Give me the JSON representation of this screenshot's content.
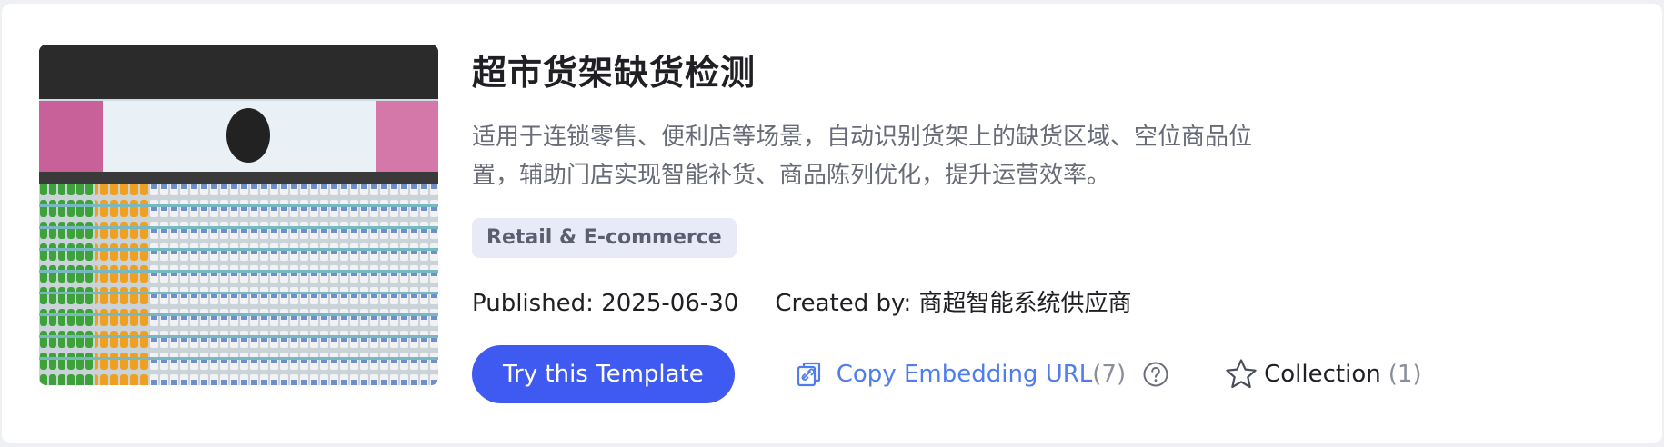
{
  "template": {
    "title": "超市货架缺货检测",
    "description": "适用于连锁零售、便利店等场景，自动识别货架上的缺货区域、空位商品位置，辅助门店实现智能补货、商品陈列优化，提升运营效率。",
    "tag": "Retail & E-commerce",
    "published": "Published: 2025-06-30",
    "created_by": "Created by: 商超智能系统供应商"
  },
  "actions": {
    "try_label": "Try this Template",
    "copy_label": "Copy Embedding URL",
    "copy_count": "(7)",
    "collection_label": "Collection",
    "collection_count": "(1)"
  },
  "icons": {
    "copy": "link-copy-icon",
    "help": "question-circle-icon",
    "collection": "star-outline-icon"
  },
  "colors": {
    "primary": "#3f5af0",
    "link": "#4f7df0",
    "tag_bg": "#e8eaf8"
  }
}
